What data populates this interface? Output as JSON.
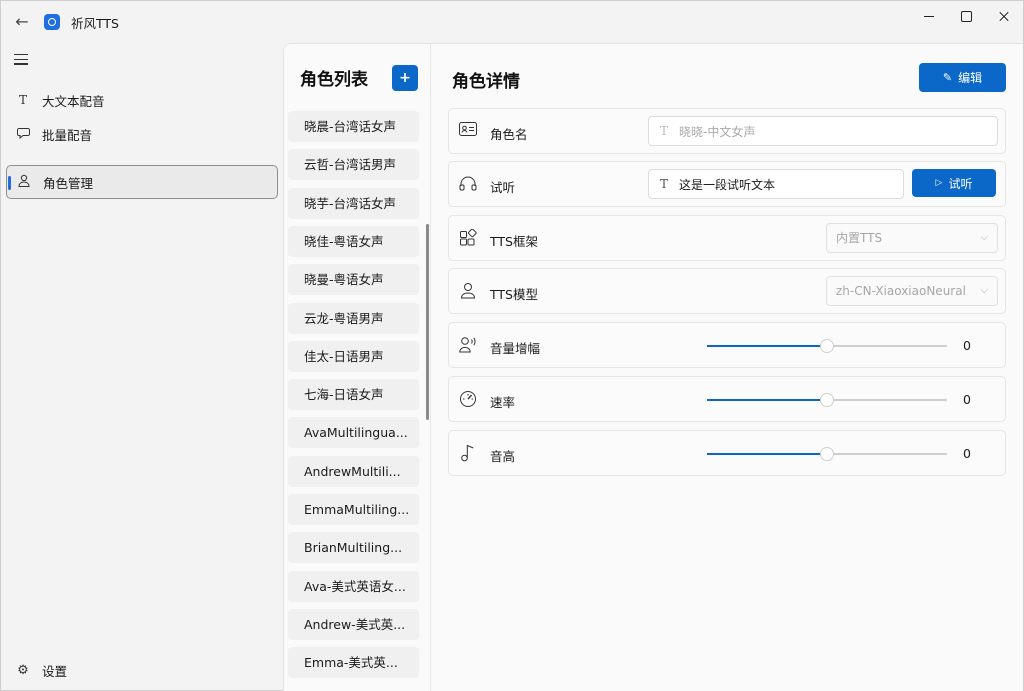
{
  "app": {
    "title": "祈风TTS"
  },
  "nav": {
    "items": [
      {
        "label": "大文本配音",
        "icon": "text-icon"
      },
      {
        "label": "批量配音",
        "icon": "chat-bubble-icon"
      },
      {
        "label": "角色管理",
        "icon": "person-icon",
        "active": true
      }
    ],
    "settings_label": "设置"
  },
  "role_list": {
    "title": "角色列表",
    "add_label": "+",
    "items": [
      "晓晨-台湾话女声",
      "云哲-台湾话男声",
      "晓芋-台湾话女声",
      "晓佳-粤语女声",
      "晓曼-粤语女声",
      "云龙-粤语男声",
      "佳太-日语男声",
      "七海-日语女声",
      "AvaMultilingua...",
      "AndrewMultili...",
      "EmmaMultiling...",
      "BrianMultiling...",
      "Ava-美式英语女...",
      "Andrew-美式英...",
      "Emma-美式英..."
    ]
  },
  "detail": {
    "title": "角色详情",
    "edit_label": "编辑",
    "name": {
      "label": "角色名",
      "placeholder": "晓晓-中文女声"
    },
    "audition": {
      "label": "试听",
      "value": "这是一段试听文本",
      "button": "试听"
    },
    "tts_frame": {
      "label": "TTS框架",
      "value": "内置TTS"
    },
    "tts_model": {
      "label": "TTS模型",
      "value": "zh-CN-XiaoxiaoNeural"
    },
    "volume": {
      "label": "音量增幅",
      "value": "0",
      "fraction": 0.5
    },
    "rate": {
      "label": "速率",
      "value": "0",
      "fraction": 0.5
    },
    "pitch": {
      "label": "音高",
      "value": "0",
      "fraction": 0.5
    }
  },
  "colors": {
    "accent": "#0b67c8"
  }
}
